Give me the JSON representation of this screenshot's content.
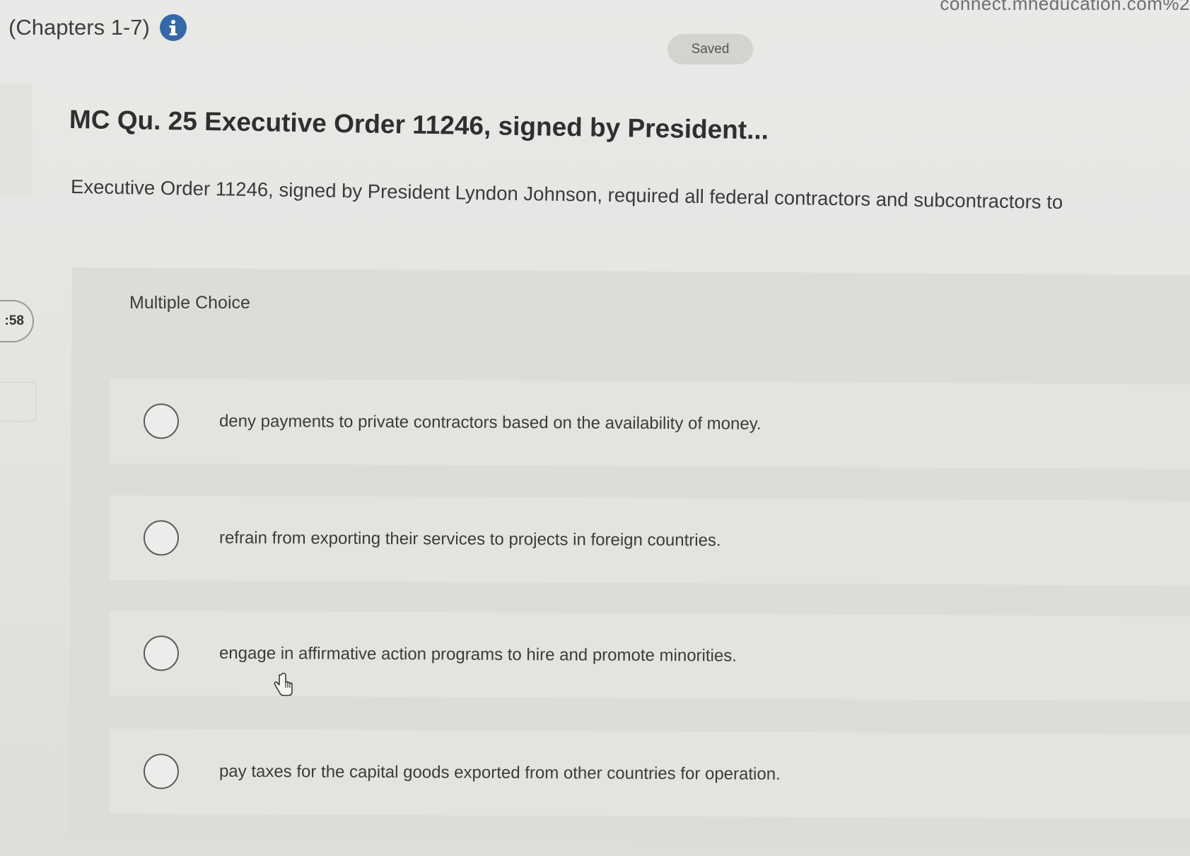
{
  "header": {
    "url_fragment": "connect.mheducation.com%2",
    "chapter_title": "(Chapters 1-7)",
    "save_status": "Saved"
  },
  "timer": {
    "display": ":58"
  },
  "question": {
    "title": "MC Qu. 25 Executive Order 11246, signed by President...",
    "prompt": "Executive Order 11246, signed by President Lyndon Johnson, required all federal contractors and subcontractors to",
    "type_label": "Multiple Choice"
  },
  "choices": [
    {
      "label": "deny payments to private contractors based on the availability of money."
    },
    {
      "label": "refrain from exporting their services to projects in foreign countries."
    },
    {
      "label": "engage in affirmative action programs to hire and promote minorities."
    },
    {
      "label": "pay taxes for the capital goods exported from other countries for operation."
    }
  ],
  "icons": {
    "info": "info-icon",
    "cursor": "hand-pointer-icon"
  },
  "colors": {
    "accent": "#3568a8"
  }
}
